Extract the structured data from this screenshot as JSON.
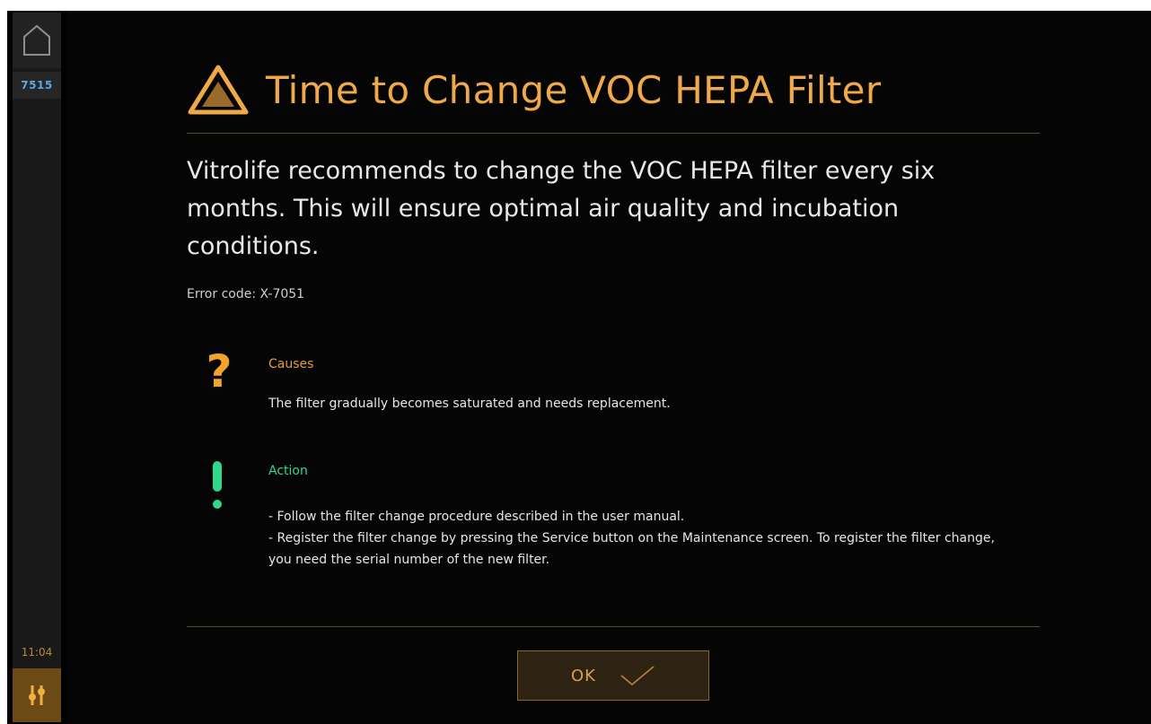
{
  "sidebar": {
    "home_icon": "home-icon",
    "instrument_id": "7515",
    "clock": "11:04",
    "settings_icon": "sliders-icon"
  },
  "dialog": {
    "icon": "warning-triangle-icon",
    "title": "Time to Change VOC HEPA Filter",
    "message": "Vitrolife recommends to change the VOC HEPA filter every six months. This will ensure optimal air quality and incubation conditions.",
    "error_code": "Error code: X-7051",
    "causes": {
      "icon": "question-mark-icon",
      "heading": "Causes",
      "text": "The filter gradually becomes saturated and needs replacement."
    },
    "action": {
      "icon": "exclamation-icon",
      "heading": "Action",
      "lines": [
        "- Follow the filter change procedure described in the user manual.",
        "- Register the filter change by pressing the Service button on the Maintenance screen. To register the filter change, you need the serial number of the new filter."
      ]
    },
    "ok_button": {
      "label": "OK",
      "icon": "checkmark-icon"
    }
  },
  "colors": {
    "accent_orange": "#f0a949",
    "action_green": "#2fd98a",
    "id_blue": "#5aa7e6",
    "background": "#050505"
  }
}
